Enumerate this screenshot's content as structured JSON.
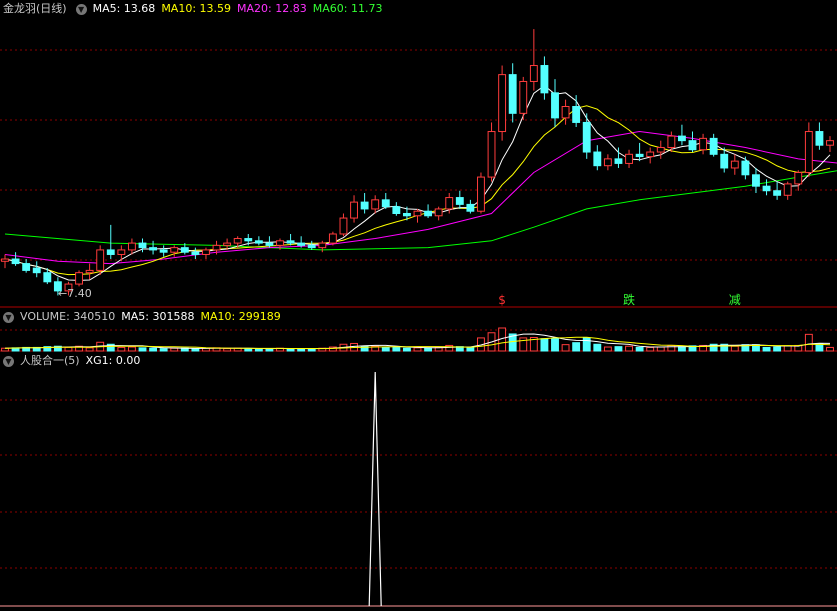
{
  "header": {
    "stock_title": "金龙羽(日线)",
    "ma5": "MA5: 13.68",
    "ma10": "MA10: 13.59",
    "ma20": "MA20: 12.83",
    "ma60": "MA60: 11.73"
  },
  "volume_panel": {
    "volume": "VOLUME: 340510",
    "ma5": "MA5: 301588",
    "ma10": "MA10: 299189"
  },
  "indicator_panel": {
    "title": "人股合一(5)",
    "xg1": "XG1: 0.00"
  },
  "annotations": {
    "low_label": "←7.40",
    "signal_s": "$",
    "signal_die": "跌",
    "signal_jian": "减"
  },
  "colors": {
    "up": "#ff3c3c",
    "down": "#54ffff",
    "ma5": "#ffffff",
    "ma10": "#ffff00",
    "ma20": "#ff00ff",
    "ma60": "#00ff00",
    "grid": "#8b0000"
  },
  "chart_data": {
    "type": "candlestick",
    "title": "金龙羽(日线)",
    "series_values": {
      "MA5": 13.68,
      "MA10": 13.59,
      "MA20": 12.83,
      "MA60": 11.73,
      "VOLUME": 340510,
      "VOL_MA5": 301588,
      "VOL_MA10": 299189,
      "XG1": 0.0
    },
    "low_mark": 7.4,
    "price_range": [
      7.2,
      19.5
    ],
    "bars": [
      [
        8.9,
        9.2,
        8.6,
        9.0
      ],
      [
        9.0,
        9.3,
        8.7,
        8.8
      ],
      [
        8.8,
        9.0,
        8.4,
        8.5
      ],
      [
        8.6,
        8.9,
        8.2,
        8.4
      ],
      [
        8.4,
        8.6,
        7.9,
        8.0
      ],
      [
        8.0,
        8.2,
        7.4,
        7.6
      ],
      [
        7.6,
        8.0,
        7.4,
        7.9
      ],
      [
        7.9,
        8.5,
        7.8,
        8.4
      ],
      [
        8.4,
        8.8,
        8.1,
        8.5
      ],
      [
        8.5,
        9.6,
        8.3,
        9.4
      ],
      [
        9.4,
        10.5,
        9.0,
        9.2
      ],
      [
        9.2,
        9.6,
        8.9,
        9.4
      ],
      [
        9.4,
        9.9,
        9.2,
        9.7
      ],
      [
        9.7,
        9.9,
        9.3,
        9.5
      ],
      [
        9.5,
        9.8,
        9.2,
        9.4
      ],
      [
        9.4,
        9.6,
        9.1,
        9.3
      ],
      [
        9.3,
        9.6,
        9.1,
        9.5
      ],
      [
        9.5,
        9.7,
        9.2,
        9.3
      ],
      [
        9.3,
        9.5,
        9.0,
        9.2
      ],
      [
        9.2,
        9.5,
        9.0,
        9.4
      ],
      [
        9.4,
        9.8,
        9.2,
        9.6
      ],
      [
        9.6,
        9.9,
        9.4,
        9.7
      ],
      [
        9.7,
        10.0,
        9.5,
        9.9
      ],
      [
        9.9,
        10.1,
        9.6,
        9.8
      ],
      [
        9.8,
        10.0,
        9.6,
        9.7
      ],
      [
        9.7,
        10.0,
        9.5,
        9.6
      ],
      [
        9.6,
        9.9,
        9.4,
        9.8
      ],
      [
        9.8,
        10.1,
        9.6,
        9.7
      ],
      [
        9.7,
        10.0,
        9.5,
        9.6
      ],
      [
        9.6,
        9.8,
        9.4,
        9.5
      ],
      [
        9.5,
        9.8,
        9.3,
        9.7
      ],
      [
        9.7,
        10.2,
        9.6,
        10.1
      ],
      [
        10.1,
        11.0,
        10.0,
        10.8
      ],
      [
        10.8,
        11.8,
        10.6,
        11.5
      ],
      [
        11.5,
        11.9,
        11.0,
        11.2
      ],
      [
        11.2,
        11.8,
        11.0,
        11.6
      ],
      [
        11.6,
        11.9,
        11.2,
        11.3
      ],
      [
        11.3,
        11.5,
        10.9,
        11.0
      ],
      [
        11.0,
        11.3,
        10.7,
        10.9
      ],
      [
        10.9,
        11.2,
        10.6,
        11.1
      ],
      [
        11.1,
        11.4,
        10.8,
        10.9
      ],
      [
        10.9,
        11.3,
        10.7,
        11.2
      ],
      [
        11.2,
        11.9,
        11.0,
        11.7
      ],
      [
        11.7,
        12.0,
        11.2,
        11.4
      ],
      [
        11.4,
        11.6,
        11.0,
        11.1
      ],
      [
        11.1,
        12.8,
        11.0,
        12.6
      ],
      [
        12.6,
        15.0,
        12.4,
        14.6
      ],
      [
        14.6,
        17.5,
        14.2,
        17.1
      ],
      [
        17.1,
        17.6,
        15.0,
        15.4
      ],
      [
        15.4,
        17.0,
        15.1,
        16.8
      ],
      [
        16.8,
        19.1,
        16.4,
        17.5
      ],
      [
        17.5,
        17.9,
        16.0,
        16.3
      ],
      [
        16.3,
        16.9,
        14.8,
        15.2
      ],
      [
        15.2,
        16.0,
        14.9,
        15.7
      ],
      [
        15.7,
        16.2,
        14.8,
        15.0
      ],
      [
        15.0,
        15.4,
        13.4,
        13.7
      ],
      [
        13.7,
        14.0,
        12.9,
        13.1
      ],
      [
        13.1,
        13.6,
        12.9,
        13.4
      ],
      [
        13.4,
        13.9,
        13.0,
        13.2
      ],
      [
        13.2,
        13.8,
        13.0,
        13.6
      ],
      [
        13.6,
        14.1,
        13.3,
        13.5
      ],
      [
        13.5,
        13.9,
        13.2,
        13.7
      ],
      [
        13.7,
        14.2,
        13.4,
        13.9
      ],
      [
        13.9,
        14.6,
        13.7,
        14.4
      ],
      [
        14.4,
        14.9,
        14.0,
        14.2
      ],
      [
        14.2,
        14.6,
        13.7,
        13.8
      ],
      [
        13.8,
        14.5,
        13.6,
        14.3
      ],
      [
        14.3,
        14.5,
        13.5,
        13.6
      ],
      [
        13.6,
        13.9,
        12.8,
        13.0
      ],
      [
        13.0,
        13.6,
        12.7,
        13.3
      ],
      [
        13.3,
        13.5,
        12.5,
        12.7
      ],
      [
        12.7,
        13.0,
        11.9,
        12.2
      ],
      [
        12.2,
        12.5,
        11.8,
        12.0
      ],
      [
        12.0,
        12.4,
        11.6,
        11.8
      ],
      [
        11.8,
        12.4,
        11.6,
        12.3
      ],
      [
        12.3,
        12.9,
        12.0,
        12.8
      ],
      [
        12.8,
        15.0,
        12.6,
        14.6
      ],
      [
        14.6,
        15.0,
        13.8,
        14.0
      ],
      [
        14.0,
        14.4,
        13.7,
        14.2
      ]
    ],
    "ma60_points": [
      [
        0,
        10.1
      ],
      [
        10,
        9.7
      ],
      [
        20,
        9.6
      ],
      [
        30,
        9.4
      ],
      [
        40,
        9.5
      ],
      [
        46,
        9.8
      ],
      [
        50,
        10.4
      ],
      [
        55,
        11.2
      ],
      [
        60,
        11.6
      ],
      [
        65,
        11.9
      ],
      [
        70,
        12.2
      ],
      [
        75,
        12.6
      ],
      [
        79,
        12.9
      ]
    ],
    "ma20_points": [
      [
        0,
        9.2
      ],
      [
        5,
        8.9
      ],
      [
        10,
        8.8
      ],
      [
        15,
        9.0
      ],
      [
        20,
        9.3
      ],
      [
        25,
        9.5
      ],
      [
        30,
        9.6
      ],
      [
        35,
        9.9
      ],
      [
        40,
        10.3
      ],
      [
        46,
        11.0
      ],
      [
        50,
        12.8
      ],
      [
        55,
        14.2
      ],
      [
        60,
        14.6
      ],
      [
        65,
        14.3
      ],
      [
        70,
        13.9
      ],
      [
        75,
        13.4
      ],
      [
        79,
        13.2
      ]
    ],
    "signals": {
      "s_index": 47,
      "die_index": 59,
      "jian_index": 69,
      "xg1_spike_index": 35
    }
  }
}
